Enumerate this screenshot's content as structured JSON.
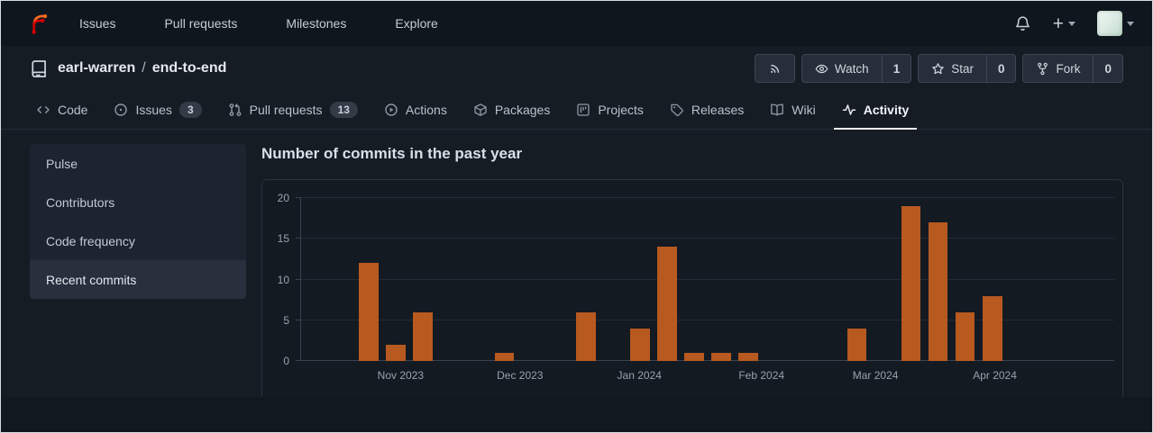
{
  "navbar": {
    "items": [
      {
        "label": "Issues"
      },
      {
        "label": "Pull requests"
      },
      {
        "label": "Milestones"
      },
      {
        "label": "Explore"
      }
    ],
    "new_button_label": "+"
  },
  "repo": {
    "owner": "earl-warren",
    "separator": "/",
    "name": "end-to-end",
    "actions": {
      "watch_label": "Watch",
      "watch_count": "1",
      "star_label": "Star",
      "star_count": "0",
      "fork_label": "Fork",
      "fork_count": "0"
    }
  },
  "tabs": [
    {
      "label": "Code"
    },
    {
      "label": "Issues",
      "badge": "3"
    },
    {
      "label": "Pull requests",
      "badge": "13"
    },
    {
      "label": "Actions"
    },
    {
      "label": "Packages"
    },
    {
      "label": "Projects"
    },
    {
      "label": "Releases"
    },
    {
      "label": "Wiki"
    },
    {
      "label": "Activity",
      "active": true
    }
  ],
  "sidebar": {
    "items": [
      {
        "label": "Pulse"
      },
      {
        "label": "Contributors"
      },
      {
        "label": "Code frequency"
      },
      {
        "label": "Recent commits",
        "active": true
      }
    ]
  },
  "chart_data": {
    "type": "bar",
    "title": "Number of commits in the past year",
    "x_unit": "week",
    "slots": 30,
    "bars": [
      {
        "slot": 2,
        "value": 12
      },
      {
        "slot": 3,
        "value": 2
      },
      {
        "slot": 4,
        "value": 6
      },
      {
        "slot": 7,
        "value": 1
      },
      {
        "slot": 10,
        "value": 6
      },
      {
        "slot": 12,
        "value": 4
      },
      {
        "slot": 13,
        "value": 14
      },
      {
        "slot": 14,
        "value": 1
      },
      {
        "slot": 15,
        "value": 1
      },
      {
        "slot": 16,
        "value": 1
      },
      {
        "slot": 20,
        "value": 4
      },
      {
        "slot": 22,
        "value": 19
      },
      {
        "slot": 23,
        "value": 17
      },
      {
        "slot": 24,
        "value": 6
      },
      {
        "slot": 25,
        "value": 8
      }
    ],
    "month_ticks": [
      {
        "slot": 3.2,
        "label": "Nov 2023"
      },
      {
        "slot": 7.6,
        "label": "Dec 2023"
      },
      {
        "slot": 12.0,
        "label": "Jan 2024"
      },
      {
        "slot": 16.5,
        "label": "Feb 2024"
      },
      {
        "slot": 20.7,
        "label": "Mar 2024"
      },
      {
        "slot": 25.1,
        "label": "Apr 2024"
      }
    ],
    "yticks": [
      0,
      5,
      10,
      15,
      20
    ],
    "ylim": [
      0,
      20
    ],
    "bar_color": "#b8591f",
    "grid": true,
    "legend": false
  }
}
